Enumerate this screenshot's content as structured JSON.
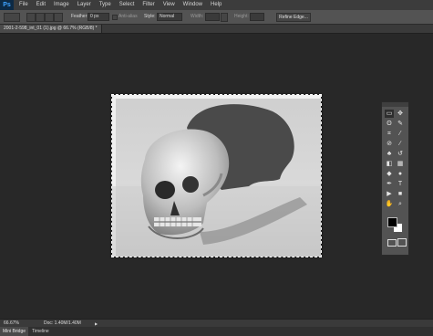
{
  "app": {
    "logo": "Ps"
  },
  "menu": [
    "File",
    "Edit",
    "Image",
    "Layer",
    "Type",
    "Select",
    "Filter",
    "View",
    "Window",
    "Help"
  ],
  "options": {
    "feather_label": "Feather:",
    "feather_value": "0 px",
    "antialias_label": "Anti-alias",
    "style_label": "Style:",
    "style_value": "Normal",
    "width_label": "Width:",
    "height_label": "Height:",
    "refine_label": "Refine Edge..."
  },
  "document": {
    "tab_title": "2001-2-598_int_01 (1).jpg @ 66.7% (RGB/8) *"
  },
  "status": {
    "zoom": "66.67%",
    "doc_info": "Doc: 1.40M/1.40M"
  },
  "bottom_tabs": [
    "Mini Bridge",
    "Timeline"
  ],
  "tools": [
    {
      "name": "marquee-tool-icon",
      "glyph": "▭"
    },
    {
      "name": "move-tool-icon",
      "glyph": "✥"
    },
    {
      "name": "lasso-tool-icon",
      "glyph": "ʘ"
    },
    {
      "name": "quick-select-tool-icon",
      "glyph": "✎"
    },
    {
      "name": "crop-tool-icon",
      "glyph": "⌗"
    },
    {
      "name": "eyedropper-tool-icon",
      "glyph": "⁄"
    },
    {
      "name": "healing-tool-icon",
      "glyph": "⊘"
    },
    {
      "name": "brush-tool-icon",
      "glyph": "∕"
    },
    {
      "name": "clone-stamp-tool-icon",
      "glyph": "♣"
    },
    {
      "name": "history-brush-tool-icon",
      "glyph": "↺"
    },
    {
      "name": "eraser-tool-icon",
      "glyph": "◧"
    },
    {
      "name": "gradient-tool-icon",
      "glyph": "▦"
    },
    {
      "name": "blur-tool-icon",
      "glyph": "◆"
    },
    {
      "name": "dodge-tool-icon",
      "glyph": "●"
    },
    {
      "name": "pen-tool-icon",
      "glyph": "✒"
    },
    {
      "name": "type-tool-icon",
      "glyph": "T"
    },
    {
      "name": "path-select-tool-icon",
      "glyph": "▶"
    },
    {
      "name": "shape-tool-icon",
      "glyph": "■"
    },
    {
      "name": "hand-tool-icon",
      "glyph": "✋"
    },
    {
      "name": "zoom-tool-icon",
      "glyph": "⌕"
    }
  ],
  "colors": {
    "foreground": "#000000",
    "background": "#ffffff",
    "ui_dark": "#282828",
    "accent": "#3fa3ff"
  }
}
